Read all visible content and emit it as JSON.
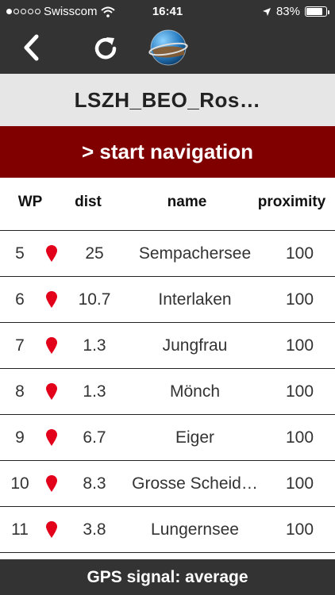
{
  "status_bar": {
    "carrier": "Swisscom",
    "time": "16:41",
    "battery_text": "83%",
    "battery_level": 0.83,
    "signal_dots_filled": 1,
    "signal_dots_total": 5
  },
  "toolbar": {
    "back_icon": "chevron-left-icon",
    "refresh_icon": "refresh-icon",
    "globe_icon": "globe-icon"
  },
  "route_title": "LSZH_BEO_Ros…",
  "start_button_label": "> start navigation",
  "table": {
    "headers": {
      "wp": "WP",
      "dist": "dist",
      "name": "name",
      "proximity": "proximity"
    },
    "rows": [
      {
        "wp": "5",
        "dist": "25",
        "name": "Sempachersee",
        "proximity": "100"
      },
      {
        "wp": "6",
        "dist": "10.7",
        "name": "Interlaken",
        "proximity": "100"
      },
      {
        "wp": "7",
        "dist": "1.3",
        "name": "Jungfrau",
        "proximity": "100"
      },
      {
        "wp": "8",
        "dist": "1.3",
        "name": "Mönch",
        "proximity": "100"
      },
      {
        "wp": "9",
        "dist": "6.7",
        "name": "Eiger",
        "proximity": "100"
      },
      {
        "wp": "10",
        "dist": "8.3",
        "name": "Grosse Scheid…",
        "proximity": "100"
      },
      {
        "wp": "11",
        "dist": "3.8",
        "name": "Lungernsee",
        "proximity": "100"
      }
    ]
  },
  "gps_status": "GPS signal: average",
  "colors": {
    "header_bg": "#333333",
    "title_bg": "#e6e6e6",
    "start_button_bg": "#800000",
    "pin": "#e3001b"
  }
}
